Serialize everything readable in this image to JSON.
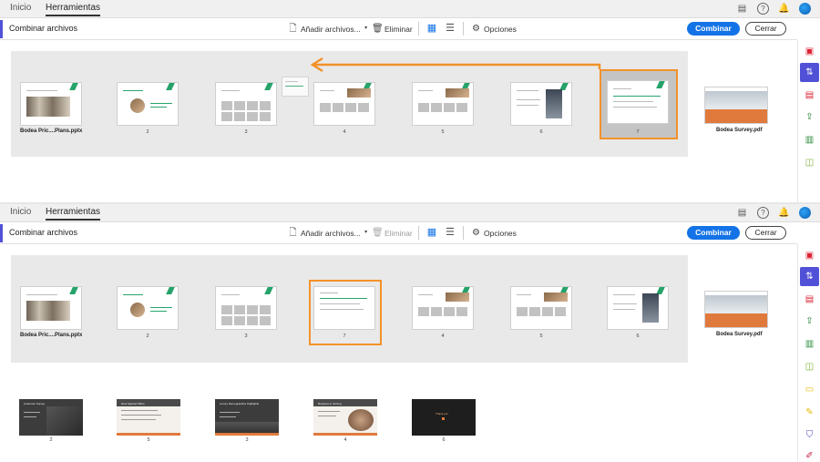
{
  "tabs": {
    "home": "Inicio",
    "tools": "Herramientas"
  },
  "toolbar": {
    "title": "Combinar archivos",
    "add_files": "Añadir archivos...",
    "delete": "Eliminar",
    "options": "Opciones",
    "combine": "Combinar",
    "close": "Cerrar"
  },
  "colors": {
    "accent": "#5151d8",
    "primary": "#1473e6",
    "highlight": "#f2922a"
  },
  "top": {
    "file1_name": "Bodea Pric....Plans.pptx",
    "file2_name": "Bodea Survey.pdf",
    "pages": [
      "2",
      "3",
      "4",
      "5",
      "6",
      "7"
    ]
  },
  "bottom": {
    "file1_name": "Bodea Pric....Plans.pptx",
    "file2_name": "Bodea Survey.pdf",
    "pages": [
      "2",
      "3",
      "7",
      "4",
      "5",
      "6"
    ],
    "strip_pages": [
      "2",
      "5",
      "3",
      "4",
      "6"
    ],
    "strip_titles": [
      "Customer Survey",
      "New Special Offers",
      "Luxury Demographics Highlights",
      "Reasons to Joining",
      "Thank you"
    ]
  }
}
